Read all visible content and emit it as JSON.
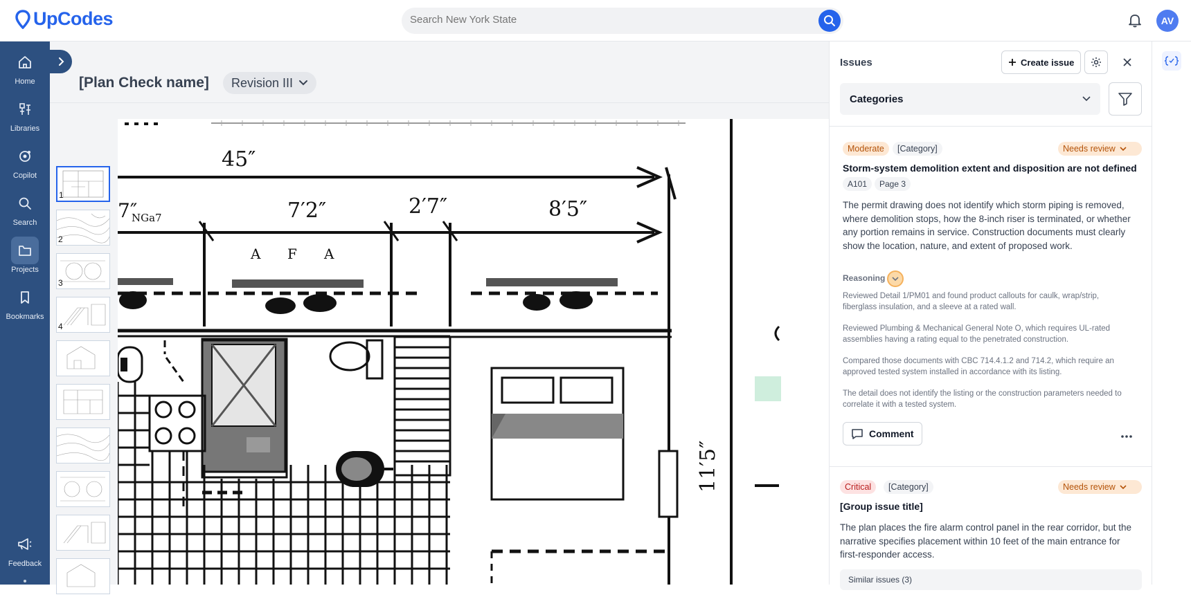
{
  "app": {
    "logo_text": "UpCodes",
    "brand_color": "#2563eb",
    "nav_color": "#2d5080"
  },
  "search": {
    "placeholder": "Search New York State"
  },
  "user": {
    "initials": "AV"
  },
  "nav": {
    "items": [
      {
        "label": "Home",
        "icon": "home-icon"
      },
      {
        "label": "Libraries",
        "icon": "libraries-icon"
      },
      {
        "label": "Copilot",
        "icon": "copilot-icon"
      },
      {
        "label": "Search",
        "icon": "search-icon"
      },
      {
        "label": "Projects",
        "icon": "folder-icon",
        "active": true
      },
      {
        "label": "Bookmarks",
        "icon": "bookmark-icon"
      }
    ],
    "feedback_label": "Feedback"
  },
  "workspace": {
    "plan_title": "[Plan Check name]",
    "revision": "Revision III",
    "thumbnails": [
      "1",
      "2",
      "3",
      "4",
      "",
      "",
      "",
      "",
      "",
      "",
      ""
    ],
    "drawing": {
      "dims": [
        "45″",
        "7″",
        "NGa7",
        "7′2″",
        "2′7″",
        "8′5″",
        "11′5″"
      ],
      "letters": [
        "A",
        "F",
        "A"
      ]
    }
  },
  "issues": {
    "title": "Issues",
    "create_label": "Create issue",
    "categories_label": "Categories",
    "items": [
      {
        "severity": "Moderate",
        "category": "[Category]",
        "status": "Needs review",
        "title": "Storm-system demolition extent and disposition are not defined",
        "tags": [
          "A101",
          "Page 3"
        ],
        "body": "The permit drawing does not identify which storm piping is removed, where demolition stops, how the 8-inch riser is terminated, or whether any portion remains in service. Construction documents must clearly show the location, nature, and extent of proposed work.",
        "reasoning_label": "Reasoning",
        "reasoning": [
          "Reviewed Detail 1/PM01 and found product callouts for caulk, wrap/strip, fiberglass insulation, and a sleeve at a rated wall.",
          "Reviewed Plumbing & Mechanical General Note O, which requires UL-rated assemblies having a rating equal to the penetrated construction.",
          "Compared those documents with CBC 714.4.1.2 and 714.2, which require an approved tested system installed in accordance with its listing.",
          "The detail does not identify the listing or the construction parameters needed to correlate it with a tested system."
        ],
        "comment_label": "Comment"
      },
      {
        "severity": "Critical",
        "category": "[Category]",
        "status": "Needs review",
        "title": "[Group issue title]",
        "body": "The plan places the fire alarm control panel in the rear corridor, but the narrative specifies placement within 10 feet of the main entrance for first-responder access.",
        "similar_label": "Similar issues (3)"
      }
    ]
  }
}
